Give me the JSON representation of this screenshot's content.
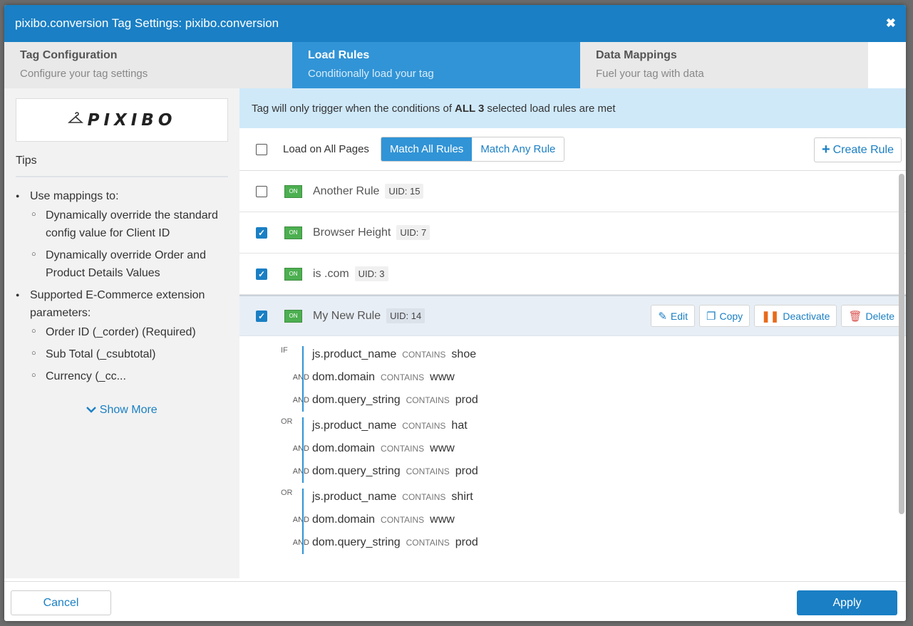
{
  "window": {
    "title": "pixibo.conversion Tag Settings: pixibo.conversion",
    "close_label": "✖"
  },
  "tabs": [
    {
      "title": "Tag Configuration",
      "subtitle": "Configure your tag settings"
    },
    {
      "title": "Load Rules",
      "subtitle": "Conditionally load your tag"
    },
    {
      "title": "Data Mappings",
      "subtitle": "Fuel your tag with data"
    }
  ],
  "sidebar": {
    "logo_text": "PIXIBO",
    "tips_heading": "Tips",
    "tips": {
      "t1": "Use mappings to:",
      "t1a": "Dynamically override the standard config value for Client ID",
      "t1b": "Dynamically override Order and Product Details Values",
      "t2": "Supported E-Commerce extension parameters:",
      "t2a": "Order ID (_corder) (Required)",
      "t2b": "Sub Total (_csubtotal)",
      "t2c": "Currency (_cc..."
    },
    "show_more": "Show More"
  },
  "main": {
    "banner_pre": "Tag will only trigger when the conditions of",
    "banner_bold": "ALL 3",
    "banner_post": "selected load rules are met",
    "load_all_pages": "Load on All Pages",
    "match_all": "Match All Rules",
    "match_any": "Match Any Rule",
    "create_rule": "Create Rule",
    "rules": [
      {
        "badge": "ON",
        "name": "Another Rule",
        "uid": "UID: 15",
        "checked": false
      },
      {
        "badge": "ON",
        "name": "Browser Height",
        "uid": "UID: 7",
        "checked": true
      },
      {
        "badge": "ON",
        "name": "is .com",
        "uid": "UID: 3",
        "checked": true
      },
      {
        "badge": "ON",
        "name": "My New Rule",
        "uid": "UID: 14",
        "checked": true
      }
    ],
    "actions": {
      "edit": "Edit",
      "copy": "Copy",
      "deactivate": "Deactivate",
      "delete": "Delete"
    },
    "conditions": {
      "g1_label": "IF",
      "g2_label": "OR",
      "g3_label": "OR",
      "and": "AND",
      "contains": "CONTAINS",
      "v_product": "js.product_name",
      "v_domain": "dom.domain",
      "v_query": "dom.query_string",
      "g1_val1": "shoe",
      "g2_val1": "hat",
      "g3_val1": "shirt",
      "val_domain": "www",
      "val_query": "prod"
    }
  },
  "footer": {
    "cancel": "Cancel",
    "apply": "Apply"
  }
}
